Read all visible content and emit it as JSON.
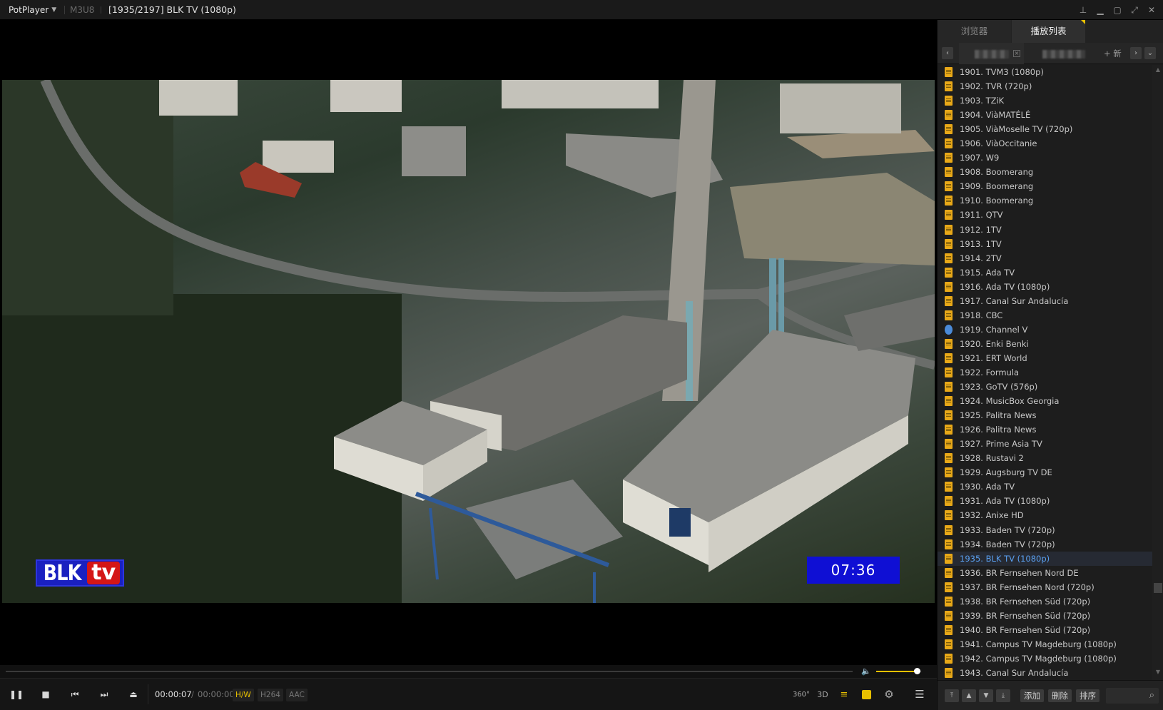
{
  "titlebar": {
    "app_name": "PotPlayer",
    "format": "M3U8",
    "now_playing": "[1935/2197] BLK TV (1080p)",
    "buttons": [
      "pin-icon",
      "minimize-icon",
      "maximize-icon",
      "fullscreen-icon",
      "close-icon"
    ]
  },
  "video": {
    "channel_logo_left": "BLK",
    "channel_logo_right": "tv",
    "overlay_clock": "07:36",
    "logo_color": "#1a20c0",
    "clock_color": "#0f0fd4"
  },
  "player": {
    "time_current": "00:00:07",
    "time_separator": "/",
    "time_total": "00:00:00",
    "decoder_badge": "H/W",
    "video_codec": "H264",
    "audio_codec": "AAC",
    "seek_progress": 0.0,
    "volume_level": 0.9,
    "accent_color": "#e8c000",
    "controls": [
      "pause-icon",
      "stop-icon",
      "previous-icon",
      "next-icon",
      "eject-icon"
    ],
    "right_controls": {
      "vr": "360°",
      "stereo": "3D"
    }
  },
  "panel": {
    "tabs": [
      "浏览器",
      "播放列表"
    ],
    "active_tab": "播放列表",
    "new_tab_label": "+ 新",
    "footer": {
      "add": "添加",
      "delete": "删除",
      "sort": "排序"
    },
    "items": [
      {
        "label": "1901. TVM3 (1080p)",
        "icon": "file"
      },
      {
        "label": "1902. TVR (720p)",
        "icon": "file"
      },
      {
        "label": "1903. TZiK",
        "icon": "file"
      },
      {
        "label": "1904. ViàMATÉLÉ",
        "icon": "file"
      },
      {
        "label": "1905. ViàMoselle TV (720p)",
        "icon": "file"
      },
      {
        "label": "1906. ViàOccitanie",
        "icon": "file"
      },
      {
        "label": "1907. W9",
        "icon": "file"
      },
      {
        "label": "1908. Boomerang",
        "icon": "file"
      },
      {
        "label": "1909. Boomerang",
        "icon": "file"
      },
      {
        "label": "1910. Boomerang",
        "icon": "file"
      },
      {
        "label": "1911. QTV",
        "icon": "file"
      },
      {
        "label": "1912. 1TV",
        "icon": "file"
      },
      {
        "label": "1913. 1TV",
        "icon": "file"
      },
      {
        "label": "1914. 2TV",
        "icon": "file"
      },
      {
        "label": "1915. Ada TV",
        "icon": "file"
      },
      {
        "label": "1916. Ada TV (1080p)",
        "icon": "file"
      },
      {
        "label": "1917. Canal Sur Andalucía",
        "icon": "file"
      },
      {
        "label": "1918. CBC",
        "icon": "file"
      },
      {
        "label": "1919. Channel V",
        "icon": "network"
      },
      {
        "label": "1920. Enki Benki",
        "icon": "file"
      },
      {
        "label": "1921. ERT World",
        "icon": "file"
      },
      {
        "label": "1922. Formula",
        "icon": "file"
      },
      {
        "label": "1923. GoTV (576p)",
        "icon": "file"
      },
      {
        "label": "1924. MusicBox Georgia",
        "icon": "file"
      },
      {
        "label": "1925. Palitra News",
        "icon": "file"
      },
      {
        "label": "1926. Palitra News",
        "icon": "file"
      },
      {
        "label": "1927. Prime Asia TV",
        "icon": "file"
      },
      {
        "label": "1928. Rustavi 2",
        "icon": "file"
      },
      {
        "label": "1929. Augsburg TV DE",
        "icon": "file"
      },
      {
        "label": "1930. Ada TV",
        "icon": "file"
      },
      {
        "label": "1931. Ada TV (1080p)",
        "icon": "file"
      },
      {
        "label": "1932. Anixe HD",
        "icon": "file"
      },
      {
        "label": "1933. Baden TV (720p)",
        "icon": "file"
      },
      {
        "label": "1934. Baden TV (720p)",
        "icon": "file"
      },
      {
        "label": "1935. BLK TV (1080p)",
        "icon": "file",
        "active": true
      },
      {
        "label": "1936. BR Fernsehen Nord DE",
        "icon": "file"
      },
      {
        "label": "1937. BR Fernsehen Nord (720p)",
        "icon": "file"
      },
      {
        "label": "1938. BR Fernsehen Süd (720p)",
        "icon": "file"
      },
      {
        "label": "1939. BR Fernsehen Süd (720p)",
        "icon": "file"
      },
      {
        "label": "1940. BR Fernsehen Süd (720p)",
        "icon": "file"
      },
      {
        "label": "1941. Campus TV Magdeburg (1080p)",
        "icon": "file"
      },
      {
        "label": "1942. Campus TV Magdeburg (1080p)",
        "icon": "file"
      },
      {
        "label": "1943. Canal Sur Andalucía",
        "icon": "file"
      }
    ]
  }
}
